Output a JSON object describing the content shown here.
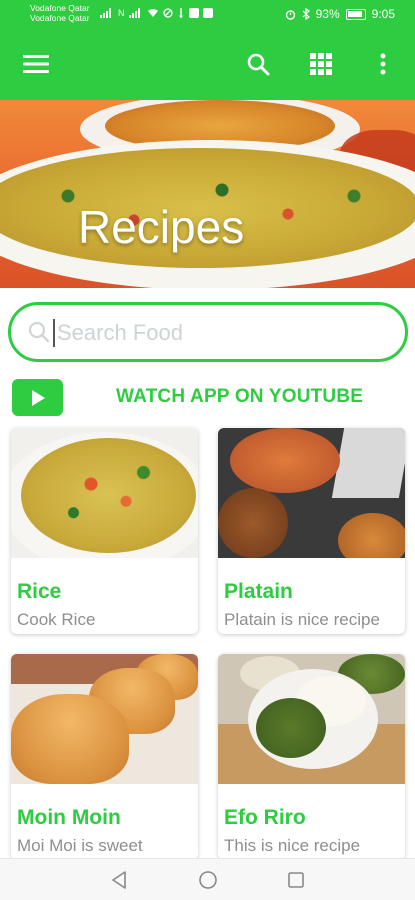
{
  "status_bar": {
    "carrier_1": "Vodafone Qatar",
    "carrier_2": "Vodafone Qatar",
    "network": "N",
    "battery": "93%",
    "time": "9:05"
  },
  "toolbar": {
    "menu_icon": "hamburger-menu-icon",
    "search_icon": "search-icon",
    "grid_icon": "grid-icon",
    "more_icon": "more-vert-icon"
  },
  "hero": {
    "title": "Recipes"
  },
  "search": {
    "placeholder": "Search Food",
    "value": ""
  },
  "youtube": {
    "label": "WATCH APP ON YOUTUBE"
  },
  "recipes": [
    {
      "title": "Rice",
      "description": "Cook Rice"
    },
    {
      "title": "Platain",
      "description": "Platain is nice recipe"
    },
    {
      "title": "Moin Moin",
      "description": "Moi Moi is sweet"
    },
    {
      "title": "Efo Riro",
      "description": "This is nice recipe"
    }
  ],
  "colors": {
    "accent": "#2ecc40",
    "text_muted": "#8e8e8e"
  }
}
